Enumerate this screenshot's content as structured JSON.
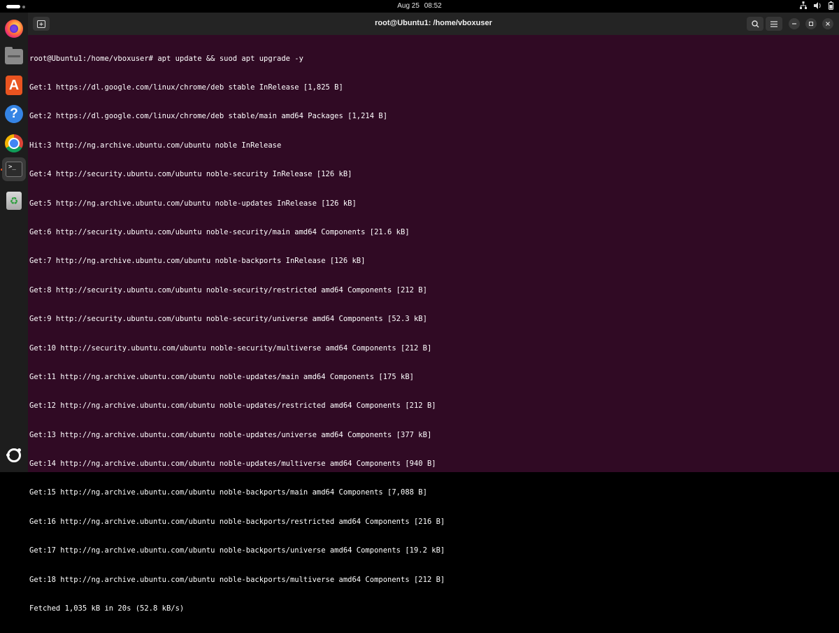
{
  "topbar": {
    "date": "Aug 25",
    "time": "08:52"
  },
  "dock": {
    "items": [
      {
        "name": "firefox-icon"
      },
      {
        "name": "files-icon"
      },
      {
        "name": "app-center-icon",
        "glyph": "A"
      },
      {
        "name": "help-icon",
        "glyph": "?"
      },
      {
        "name": "chrome-icon"
      },
      {
        "name": "terminal-icon",
        "glyph": ">_",
        "active": true
      },
      {
        "name": "trash-icon",
        "glyph": "♻"
      },
      {
        "name": "show-apps-icon"
      }
    ]
  },
  "window": {
    "title": "root@Ubuntu1: /home/vboxuser",
    "buttons": [
      "new-tab-icon",
      "search-icon",
      "menu-icon",
      "minimize-icon",
      "maximize-icon",
      "close-icon"
    ]
  },
  "terminal": {
    "lines": [
      "root@Ubuntu1:/home/vboxuser# apt update && suod apt upgrade -y",
      "Get:1 https://dl.google.com/linux/chrome/deb stable InRelease [1,825 B]",
      "Get:2 https://dl.google.com/linux/chrome/deb stable/main amd64 Packages [1,214 B]",
      "Hit:3 http://ng.archive.ubuntu.com/ubuntu noble InRelease",
      "Get:4 http://security.ubuntu.com/ubuntu noble-security InRelease [126 kB]",
      "Get:5 http://ng.archive.ubuntu.com/ubuntu noble-updates InRelease [126 kB]",
      "Get:6 http://security.ubuntu.com/ubuntu noble-security/main amd64 Components [21.6 kB]",
      "Get:7 http://ng.archive.ubuntu.com/ubuntu noble-backports InRelease [126 kB]",
      "Get:8 http://security.ubuntu.com/ubuntu noble-security/restricted amd64 Components [212 B]",
      "Get:9 http://security.ubuntu.com/ubuntu noble-security/universe amd64 Components [52.3 kB]",
      "Get:10 http://security.ubuntu.com/ubuntu noble-security/multiverse amd64 Components [212 B]",
      "Get:11 http://ng.archive.ubuntu.com/ubuntu noble-updates/main amd64 Components [175 kB]",
      "Get:12 http://ng.archive.ubuntu.com/ubuntu noble-updates/restricted amd64 Components [212 B]",
      "Get:13 http://ng.archive.ubuntu.com/ubuntu noble-updates/universe amd64 Components [377 kB]",
      "Get:14 http://ng.archive.ubuntu.com/ubuntu noble-updates/multiverse amd64 Components [940 B]",
      "Get:15 http://ng.archive.ubuntu.com/ubuntu noble-backports/main amd64 Components [7,088 B]",
      "Get:16 http://ng.archive.ubuntu.com/ubuntu noble-backports/restricted amd64 Components [216 B]",
      "Get:17 http://ng.archive.ubuntu.com/ubuntu noble-backports/universe amd64 Components [19.2 kB]",
      "Get:18 http://ng.archive.ubuntu.com/ubuntu noble-backports/multiverse amd64 Components [212 B]",
      "Fetched 1,035 kB in 20s (52.8 kB/s)"
    ]
  },
  "colors": {
    "terminal_bg": "#300a24",
    "terminal_fg": "#ffffff",
    "titlebar_bg": "#242424",
    "dock_bg": "#1d1d1d",
    "accent": "#e95420"
  }
}
